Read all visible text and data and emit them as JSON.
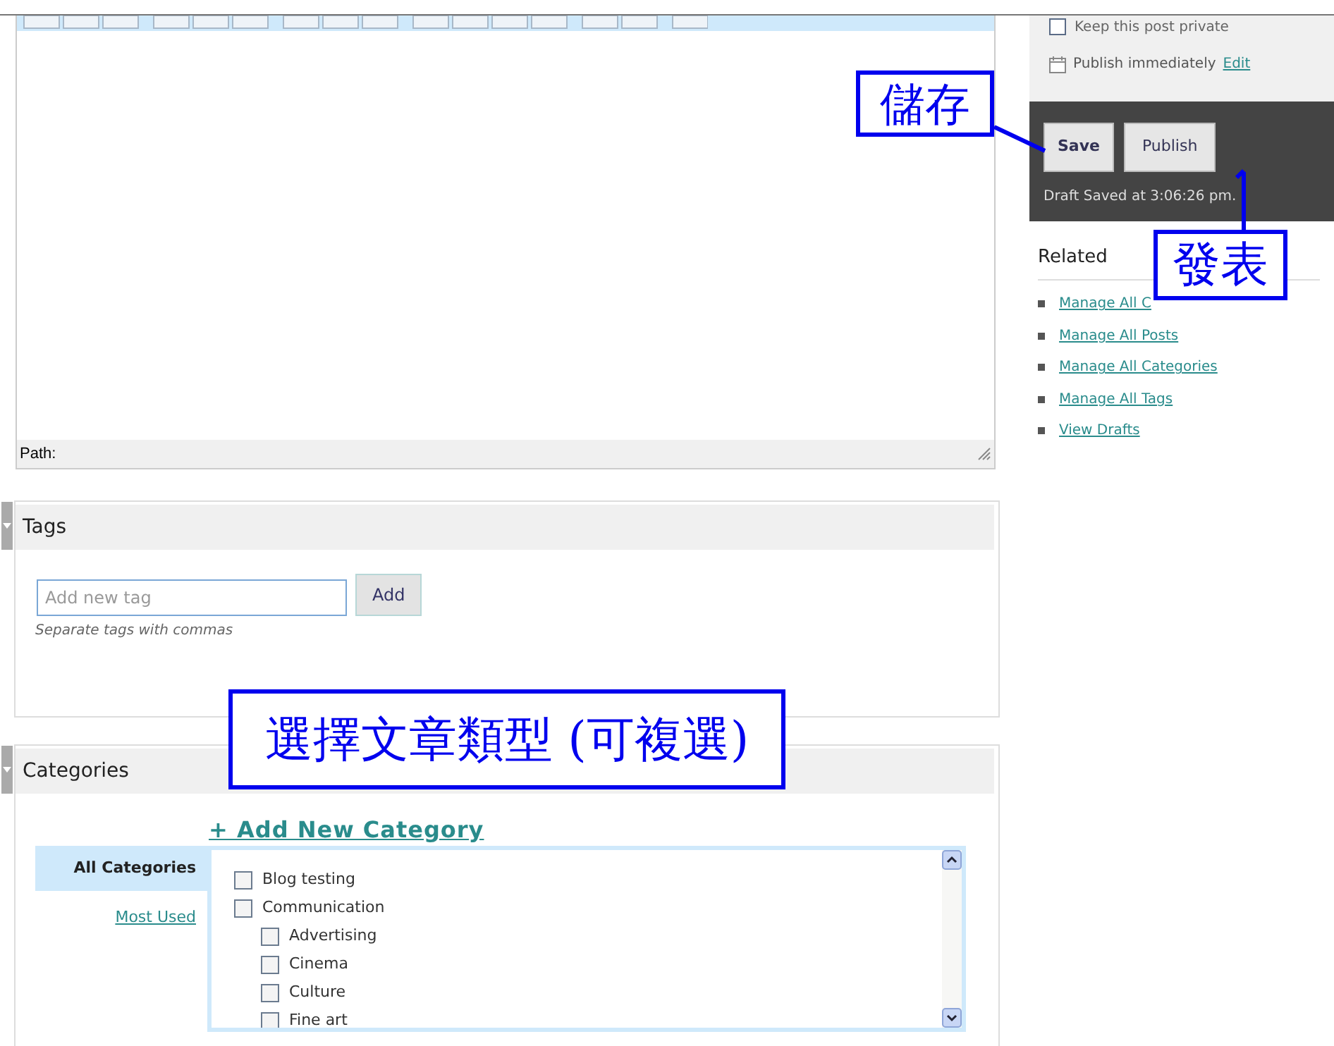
{
  "editor": {
    "path_label": "Path:"
  },
  "tags": {
    "title": "Tags",
    "input": {
      "placeholder": "Add new tag"
    },
    "add_button": "Add",
    "hint": "Separate tags with commas"
  },
  "categories": {
    "title": "Categories",
    "add_link": "+ Add New Category",
    "tabs": [
      {
        "label": "All Categories",
        "selected": true
      },
      {
        "label": "Most Used",
        "selected": false
      }
    ],
    "items": [
      {
        "label": "Blog testing",
        "checked": false
      },
      {
        "label": "Communication",
        "checked": false,
        "children": [
          {
            "label": "Advertising",
            "checked": false
          },
          {
            "label": "Cinema",
            "checked": false
          },
          {
            "label": "Culture",
            "checked": false
          },
          {
            "label": "Fine art",
            "checked": false
          }
        ]
      }
    ]
  },
  "publish": {
    "private_checkbox": {
      "label": "Keep this post private",
      "checked": false
    },
    "schedule": "Publish immediately",
    "edit_link": "Edit",
    "buttons": [
      {
        "label": "Save",
        "kind": "primary"
      },
      {
        "label": "Publish",
        "kind": "secondary"
      }
    ],
    "status": "Draft Saved at 3:06:26 pm."
  },
  "related": {
    "title": "Related",
    "links": [
      "Manage All C",
      "Manage All Posts",
      "Manage All Categories",
      "Manage All Tags",
      "View Drafts"
    ]
  },
  "annotations": [
    {
      "text": "儲存"
    },
    {
      "text": "發表"
    },
    {
      "text": "選擇文章類型 (可複選)"
    }
  ]
}
